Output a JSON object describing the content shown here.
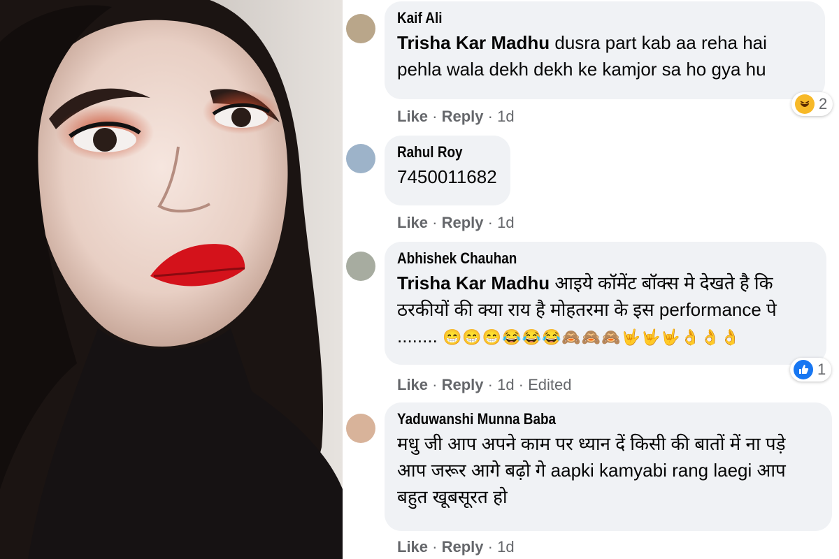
{
  "comments": [
    {
      "author": "Kaif Ali",
      "mention": "Trisha Kar Madhu",
      "text": " dusra part kab aa reha hai pehla wala dekh dekh ke kamjor sa ho gya hu",
      "like": "Like",
      "reply": "Reply",
      "time": "1d",
      "reaction_icon": "laughing-emoji-icon",
      "reaction_count": "2"
    },
    {
      "author": "Rahul Roy",
      "text": "7450011682",
      "like": "Like",
      "reply": "Reply",
      "time": "1d"
    },
    {
      "author": "Abhishek Chauhan",
      "mention": "Trisha Kar Madhu",
      "text": " आइये कॉमेंट बॉक्स मे देखते है कि ठरकीयों की क्या राय है मोहतरमा के इस performance पे ........",
      "emojis": "😁😁😁😂😂😂🙈🙈🙈🤟🤟🤟👌👌👌",
      "like": "Like",
      "reply": "Reply",
      "time": "1d",
      "edited": "Edited",
      "reaction_icon": "like-thumb-icon",
      "reaction_count": "1"
    },
    {
      "author": "Yaduwanshi Munna Baba",
      "text": "मधु जी आप अपने काम पर ध्यान दें किसी की बातों में ना पड़े आप जरूर आगे बढ़ो गे aapki kamyabi rang laegi आप बहुत खूबसूरत हो",
      "like": "Like",
      "reply": "Reply",
      "time": "1d"
    }
  ],
  "colors": {
    "bubble": "#f0f2f5",
    "meta": "#65676b",
    "like_blue": "#1877f2",
    "lipstick": "#d4121b"
  }
}
